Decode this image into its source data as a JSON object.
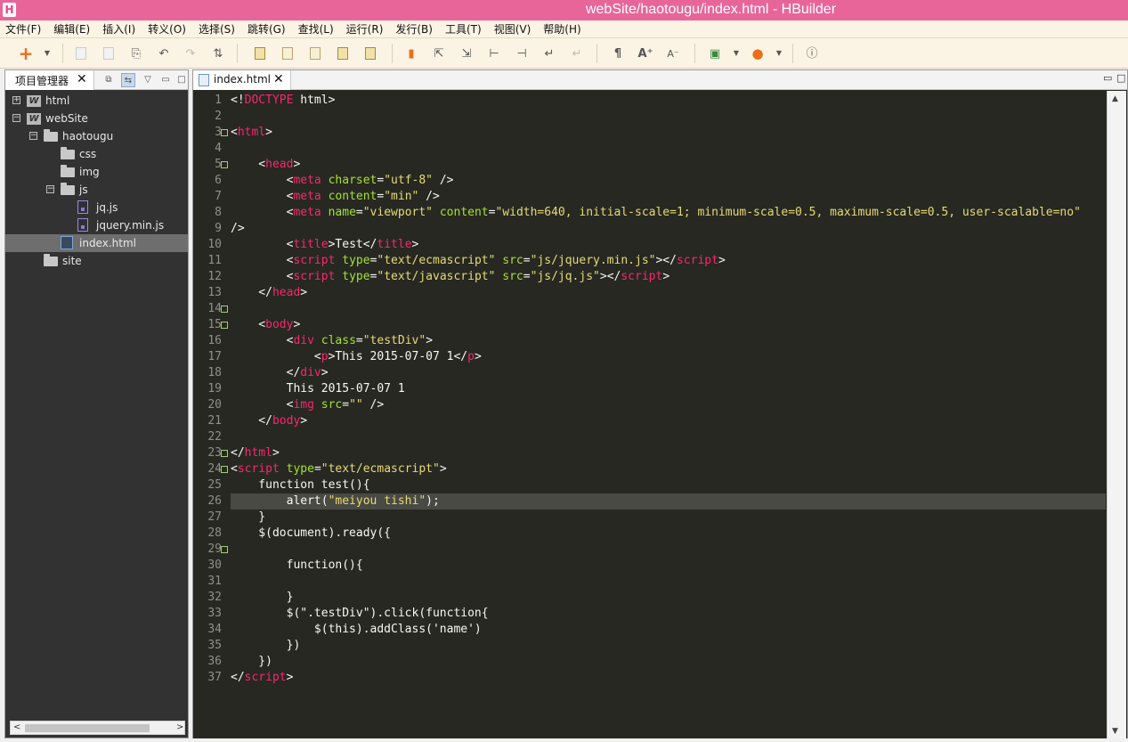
{
  "window": {
    "title": "webSite/haotougu/index.html  -  HBuilder",
    "logo_letter": "H"
  },
  "menu": [
    "文件(F)",
    "编辑(E)",
    "插入(I)",
    "转义(O)",
    "选择(S)",
    "跳转(G)",
    "查找(L)",
    "运行(R)",
    "发行(B)",
    "工具(T)",
    "视图(V)",
    "帮助(H)"
  ],
  "toolbar": {
    "icons": [
      "new-plus-icon",
      "dropdown-icon",
      "save-icon",
      "save-all-icon",
      "revert-icon",
      "undo-icon",
      "redo-icon",
      "format-icon",
      "html-icon",
      "css-icon",
      "js-icon",
      "header-icon",
      "footer-icon",
      "bookmark-icon",
      "goto-start-icon",
      "goto-end-icon",
      "jump-left-icon",
      "jump-right-icon",
      "wrap-icon",
      "disabled-wrap-icon",
      "pilcrow-icon",
      "font-increase-icon",
      "font-decrease-icon",
      "run-browser-icon",
      "firefox-icon",
      "info-icon"
    ]
  },
  "project_panel": {
    "tab_label": "项目管理器",
    "tree": [
      {
        "label": "html",
        "depth": 0,
        "kind": "project",
        "expander": "+"
      },
      {
        "label": "webSite",
        "depth": 0,
        "kind": "project",
        "expander": "−"
      },
      {
        "label": "haotougu",
        "depth": 1,
        "kind": "folder",
        "expander": "−"
      },
      {
        "label": "css",
        "depth": 2,
        "kind": "folder",
        "expander": ""
      },
      {
        "label": "img",
        "depth": 2,
        "kind": "folder",
        "expander": ""
      },
      {
        "label": "js",
        "depth": 2,
        "kind": "folder",
        "expander": "−"
      },
      {
        "label": "jq.js",
        "depth": 3,
        "kind": "js",
        "expander": ""
      },
      {
        "label": "jquery.min.js",
        "depth": 3,
        "kind": "js",
        "expander": ""
      },
      {
        "label": "index.html",
        "depth": 2,
        "kind": "html",
        "expander": "",
        "selected": true
      },
      {
        "label": "site",
        "depth": 1,
        "kind": "folder",
        "expander": ""
      }
    ]
  },
  "editor": {
    "tab_label": "index.html",
    "current_line": 25,
    "fold_lines": [
      3,
      5,
      14,
      15,
      23,
      24,
      29
    ],
    "lines": [
      [
        [
          "<!",
          "p"
        ],
        [
          "DOCTYPE",
          "t"
        ],
        [
          " html>",
          "p"
        ]
      ],
      [],
      [
        [
          "<",
          "p"
        ],
        [
          "html",
          "t"
        ],
        [
          ">",
          "p"
        ]
      ],
      [],
      [
        [
          "    <",
          "p"
        ],
        [
          "head",
          "t"
        ],
        [
          ">",
          "p"
        ]
      ],
      [
        [
          "        <",
          "p"
        ],
        [
          "meta",
          "t"
        ],
        [
          " ",
          "p"
        ],
        [
          "charset",
          "a"
        ],
        [
          "=",
          "p"
        ],
        [
          "\"utf-8\"",
          "s"
        ],
        [
          " />",
          "p"
        ]
      ],
      [
        [
          "        <",
          "p"
        ],
        [
          "meta",
          "t"
        ],
        [
          " ",
          "p"
        ],
        [
          "content",
          "a"
        ],
        [
          "=",
          "p"
        ],
        [
          "\"min\"",
          "s"
        ],
        [
          " />",
          "p"
        ]
      ],
      [
        [
          "        <",
          "p"
        ],
        [
          "meta",
          "t"
        ],
        [
          " ",
          "p"
        ],
        [
          "name",
          "a"
        ],
        [
          "=",
          "p"
        ],
        [
          "\"viewport\"",
          "s"
        ],
        [
          " ",
          "p"
        ],
        [
          "content",
          "a"
        ],
        [
          "=",
          "p"
        ],
        [
          "\"width=640, initial-scale=1; minimum-scale=0.5, maximum-scale=0.5, user-scalable=no\"",
          "s"
        ]
      ],
      [
        [
          "/>",
          "p"
        ]
      ],
      [
        [
          "        <",
          "p"
        ],
        [
          "title",
          "t"
        ],
        [
          ">Test</",
          "p"
        ],
        [
          "title",
          "t"
        ],
        [
          ">",
          "p"
        ]
      ],
      [
        [
          "        <",
          "p"
        ],
        [
          "script",
          "t"
        ],
        [
          " ",
          "p"
        ],
        [
          "type",
          "a"
        ],
        [
          "=",
          "p"
        ],
        [
          "\"text/ecmascript\"",
          "s"
        ],
        [
          " ",
          "p"
        ],
        [
          "src",
          "a"
        ],
        [
          "=",
          "p"
        ],
        [
          "\"js/jquery.min.js\"",
          "s"
        ],
        [
          "></",
          "p"
        ],
        [
          "script",
          "t"
        ],
        [
          ">",
          "p"
        ]
      ],
      [
        [
          "        <",
          "p"
        ],
        [
          "script",
          "t"
        ],
        [
          " ",
          "p"
        ],
        [
          "type",
          "a"
        ],
        [
          "=",
          "p"
        ],
        [
          "\"text/javascript\"",
          "s"
        ],
        [
          " ",
          "p"
        ],
        [
          "src",
          "a"
        ],
        [
          "=",
          "p"
        ],
        [
          "\"js/jq.js\"",
          "s"
        ],
        [
          "></",
          "p"
        ],
        [
          "script",
          "t"
        ],
        [
          ">",
          "p"
        ]
      ],
      [
        [
          "    </",
          "p"
        ],
        [
          "head",
          "t"
        ],
        [
          ">",
          "p"
        ]
      ],
      [],
      [
        [
          "    <",
          "p"
        ],
        [
          "body",
          "t"
        ],
        [
          ">",
          "p"
        ]
      ],
      [
        [
          "        <",
          "p"
        ],
        [
          "div",
          "t"
        ],
        [
          " ",
          "p"
        ],
        [
          "class",
          "a"
        ],
        [
          "=",
          "p"
        ],
        [
          "\"testDiv\"",
          "s"
        ],
        [
          ">",
          "p"
        ]
      ],
      [
        [
          "            <",
          "p"
        ],
        [
          "p",
          "t"
        ],
        [
          ">This 2015-07-07 1</",
          "p"
        ],
        [
          "p",
          "t"
        ],
        [
          ">",
          "p"
        ]
      ],
      [
        [
          "        </",
          "p"
        ],
        [
          "div",
          "t"
        ],
        [
          ">",
          "p"
        ]
      ],
      [
        [
          "        This 2015-07-07 1",
          "p"
        ]
      ],
      [
        [
          "        <",
          "p"
        ],
        [
          "img",
          "t"
        ],
        [
          " ",
          "p"
        ],
        [
          "src",
          "a"
        ],
        [
          "=",
          "p"
        ],
        [
          "\"\"",
          "s"
        ],
        [
          " />",
          "p"
        ]
      ],
      [
        [
          "    </",
          "p"
        ],
        [
          "body",
          "t"
        ],
        [
          ">",
          "p"
        ]
      ],
      [],
      [
        [
          "</",
          "p"
        ],
        [
          "html",
          "t"
        ],
        [
          ">",
          "p"
        ]
      ],
      [
        [
          "<",
          "p"
        ],
        [
          "script",
          "t"
        ],
        [
          " ",
          "p"
        ],
        [
          "type",
          "a"
        ],
        [
          "=",
          "p"
        ],
        [
          "\"text/ecmascript\"",
          "s"
        ],
        [
          ">",
          "p"
        ]
      ],
      [
        [
          "    function test(){",
          "p"
        ]
      ],
      [
        [
          "        alert(",
          "p"
        ],
        [
          "\"meiyou tishi\"",
          "s"
        ],
        [
          ");",
          "p"
        ]
      ],
      [
        [
          "    }",
          "p"
        ]
      ],
      [
        [
          "    $(document).ready({",
          "p"
        ]
      ],
      [],
      [
        [
          "        function(){",
          "p"
        ]
      ],
      [],
      [
        [
          "        }",
          "p"
        ]
      ],
      [
        [
          "        $(\".testDiv\").click(function{",
          "p"
        ]
      ],
      [
        [
          "            $(this).addClass('name')",
          "p"
        ]
      ],
      [
        [
          "        })",
          "p"
        ]
      ],
      [
        [
          "    })",
          "p"
        ]
      ],
      [
        [
          "</",
          "p"
        ],
        [
          "script",
          "t"
        ],
        [
          ">",
          "p"
        ]
      ]
    ]
  },
  "colors": {
    "titlebar": "#e8659a",
    "editor_bg": "#272822",
    "tag": "#f92672",
    "attr": "#a6e22e",
    "string": "#e6db74"
  }
}
